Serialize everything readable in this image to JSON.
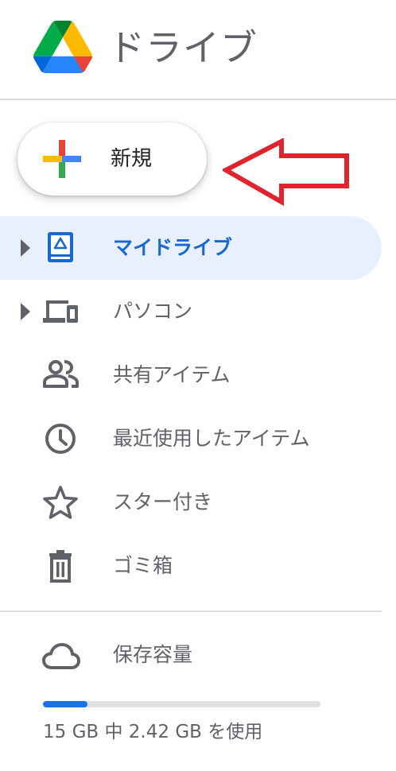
{
  "header": {
    "app_title": "ドライブ",
    "logo_icon": "google-drive-logo"
  },
  "new_button": {
    "label": "新規",
    "icon": "colored-plus-icon"
  },
  "annotation": {
    "arrow_color": "#e0232c",
    "direction": "left"
  },
  "nav": {
    "items": [
      {
        "label": "マイドライブ",
        "icon": "my-drive-icon",
        "active": true,
        "expandable": true
      },
      {
        "label": "パソコン",
        "icon": "computers-icon",
        "active": false,
        "expandable": true
      },
      {
        "label": "共有アイテム",
        "icon": "shared-people-icon",
        "active": false,
        "expandable": false
      },
      {
        "label": "最近使用したアイテム",
        "icon": "clock-icon",
        "active": false,
        "expandable": false
      },
      {
        "label": "スター付き",
        "icon": "star-icon",
        "active": false,
        "expandable": false
      },
      {
        "label": "ゴミ箱",
        "icon": "trash-icon",
        "active": false,
        "expandable": false
      }
    ]
  },
  "storage": {
    "label": "保存容量",
    "icon": "cloud-icon",
    "usage_text": "15 GB 中 2.42 GB を使用",
    "used_fraction": 0.161
  },
  "colors": {
    "accent": "#1a73e8",
    "active_text": "#1967d2",
    "active_bg": "#e8f0fe",
    "text_secondary": "#5f6368",
    "icon_gray": "#5f6368"
  }
}
